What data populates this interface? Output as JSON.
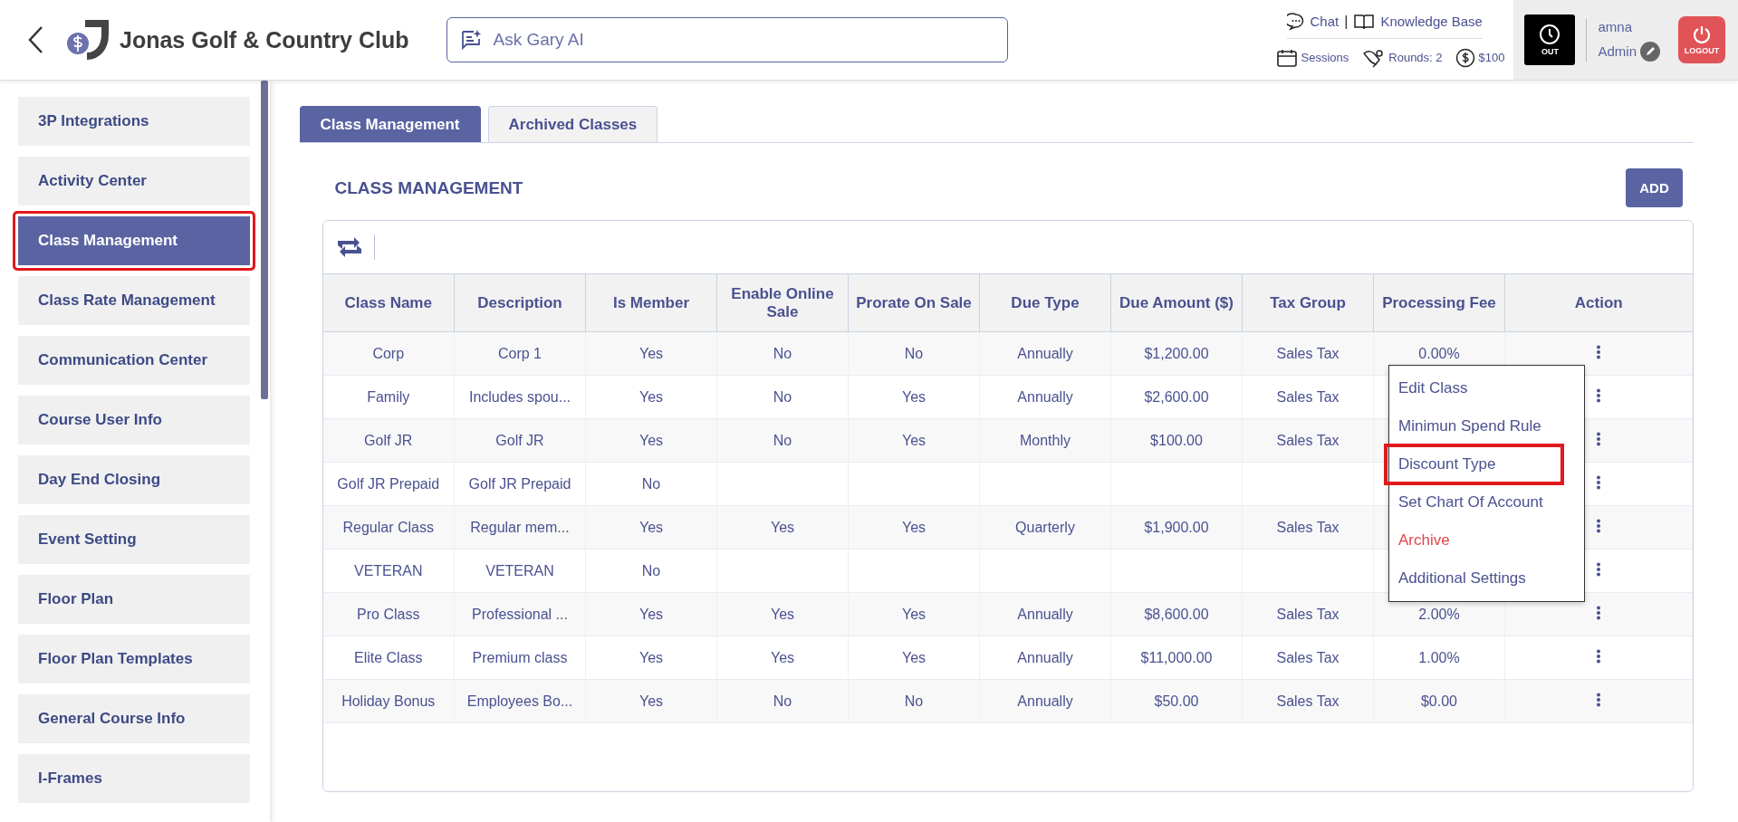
{
  "header": {
    "title": "Jonas Golf & Country Club",
    "search": {
      "placeholder": "Ask Gary AI"
    },
    "links": [
      "Chat",
      "Knowledge Base"
    ],
    "link_divider": "|",
    "stats": [
      {
        "kind": "sessions",
        "label": "Sessions"
      },
      {
        "kind": "rounds",
        "label": "Rounds: 2"
      },
      {
        "kind": "money",
        "label": "$100"
      }
    ],
    "clock_button": "OUT",
    "user": {
      "name": "amna",
      "role": "Admin"
    },
    "logout_button": "LOGOUT"
  },
  "sidebar": {
    "items": [
      {
        "label": "3P Integrations",
        "selected": false,
        "highlighted": false
      },
      {
        "label": "Activity Center",
        "selected": false,
        "highlighted": false
      },
      {
        "label": "Class Management",
        "selected": true,
        "highlighted": true
      },
      {
        "label": "Class Rate Management",
        "selected": false,
        "highlighted": false
      },
      {
        "label": "Communication Center",
        "selected": false,
        "highlighted": false
      },
      {
        "label": "Course User Info",
        "selected": false,
        "highlighted": false
      },
      {
        "label": "Day End Closing",
        "selected": false,
        "highlighted": false
      },
      {
        "label": "Event Setting",
        "selected": false,
        "highlighted": false
      },
      {
        "label": "Floor Plan",
        "selected": false,
        "highlighted": false
      },
      {
        "label": "Floor Plan Templates",
        "selected": false,
        "highlighted": false
      },
      {
        "label": "General Course Info",
        "selected": false,
        "highlighted": false
      },
      {
        "label": "I-Frames",
        "selected": false,
        "highlighted": false
      }
    ]
  },
  "tabs": [
    {
      "label": "Class Management",
      "selected": true
    },
    {
      "label": "Archived Classes",
      "selected": false
    }
  ],
  "section_title": "CLASS MANAGEMENT",
  "add_button": "ADD",
  "table": {
    "columns": [
      "Class Name",
      "Description",
      "Is Member",
      "Enable Online Sale",
      "Prorate On Sale",
      "Due Type",
      "Due Amount ($)",
      "Tax Group",
      "Processing Fee",
      "Action"
    ],
    "rows": [
      {
        "cells": [
          "Corp",
          "Corp 1",
          "Yes",
          "No",
          "No",
          "Annually",
          "$1,200.00",
          "Sales Tax",
          "0.00%"
        ],
        "menu_open": true
      },
      {
        "cells": [
          "Family",
          "Includes spou...",
          "Yes",
          "No",
          "Yes",
          "Annually",
          "$2,600.00",
          "Sales Tax",
          ""
        ],
        "menu_open": false
      },
      {
        "cells": [
          "Golf JR",
          "Golf JR",
          "Yes",
          "No",
          "Yes",
          "Monthly",
          "$100.00",
          "Sales Tax",
          ""
        ],
        "menu_open": false
      },
      {
        "cells": [
          "Golf JR Prepaid",
          "Golf JR Prepaid",
          "No",
          "",
          "",
          "",
          "",
          "",
          ""
        ],
        "menu_open": false
      },
      {
        "cells": [
          "Regular Class",
          "Regular mem...",
          "Yes",
          "Yes",
          "Yes",
          "Quarterly",
          "$1,900.00",
          "Sales Tax",
          ""
        ],
        "menu_open": false
      },
      {
        "cells": [
          "VETERAN",
          "VETERAN",
          "No",
          "",
          "",
          "",
          "",
          "",
          ""
        ],
        "menu_open": false
      },
      {
        "cells": [
          "Pro Class",
          "Professional ...",
          "Yes",
          "Yes",
          "Yes",
          "Annually",
          "$8,600.00",
          "Sales Tax",
          "2.00%"
        ],
        "menu_open": false
      },
      {
        "cells": [
          "Elite Class",
          "Premium class",
          "Yes",
          "Yes",
          "Yes",
          "Annually",
          "$11,000.00",
          "Sales Tax",
          "1.00%"
        ],
        "menu_open": false
      },
      {
        "cells": [
          "Holiday Bonus",
          "Employees Bo...",
          "Yes",
          "No",
          "No",
          "Annually",
          "$50.00",
          "Sales Tax",
          "$0.00"
        ],
        "menu_open": false
      }
    ]
  },
  "action_menu": {
    "items": [
      {
        "label": "Edit Class",
        "kind": "normal",
        "highlighted": false
      },
      {
        "label": "Minimun Spend Rule",
        "kind": "normal",
        "highlighted": false
      },
      {
        "label": "Discount Type",
        "kind": "normal",
        "highlighted": true
      },
      {
        "label": "Set Chart Of Account",
        "kind": "normal",
        "highlighted": false
      },
      {
        "label": "Archive",
        "kind": "danger",
        "highlighted": false
      },
      {
        "label": "Additional Settings",
        "kind": "normal",
        "highlighted": false
      }
    ]
  }
}
